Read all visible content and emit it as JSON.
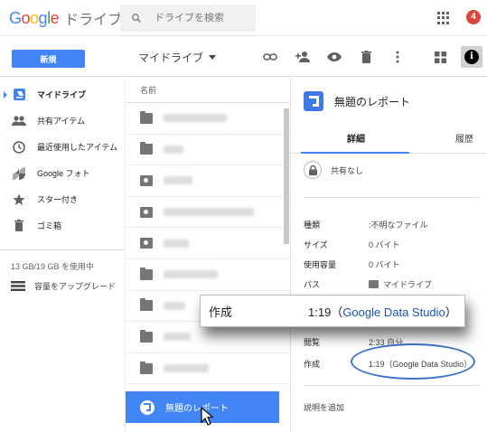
{
  "header": {
    "logo_google": "Google",
    "logo_product": "ドライブ",
    "search_placeholder": "ドライブを検索",
    "notification_count": "4"
  },
  "toolbar": {
    "new_label": "新規",
    "location_label": "マイドライブ"
  },
  "sidebar": {
    "items": [
      {
        "label": "マイドライブ",
        "icon": "drive-icon",
        "active": true
      },
      {
        "label": "共有アイテム",
        "icon": "people-icon"
      },
      {
        "label": "最近使用したアイテム",
        "icon": "clock-icon"
      },
      {
        "label": "Google フォト",
        "icon": "photos-icon"
      },
      {
        "label": "スター付き",
        "icon": "star-icon"
      },
      {
        "label": "ゴミ箱",
        "icon": "trash-icon"
      }
    ],
    "storage_text": "13 GB/19 GB を使用中",
    "upgrade_label": "容量をアップグレード"
  },
  "filelist": {
    "column_name": "名前",
    "selected_file": "無題のレポート"
  },
  "details": {
    "title": "無題のレポート",
    "tab_details": "詳細",
    "tab_history": "履歴",
    "sharing": "共有なし",
    "props": {
      "type_key": "種類",
      "type_val": ":不明なファイル",
      "size_key": "サイズ",
      "size_val": "0 バイト",
      "used_key": "使用容量",
      "used_val": "0 バイト",
      "path_key": "パス",
      "path_val": "マイドライブ",
      "viewed_key": "閲覧",
      "viewed_val": "2:33 自分",
      "created_key": "作成",
      "created_time": "1:19（",
      "created_app": "Google Data Studio",
      "created_close": "）"
    },
    "add_description": "説明を追加"
  },
  "callout": {
    "key": "作成",
    "time": "1:19（",
    "app": "Google Data Studio",
    "close": "）"
  },
  "colors": {
    "accent": "#4285f4",
    "link": "#1a55b7",
    "badge": "#db4437"
  }
}
